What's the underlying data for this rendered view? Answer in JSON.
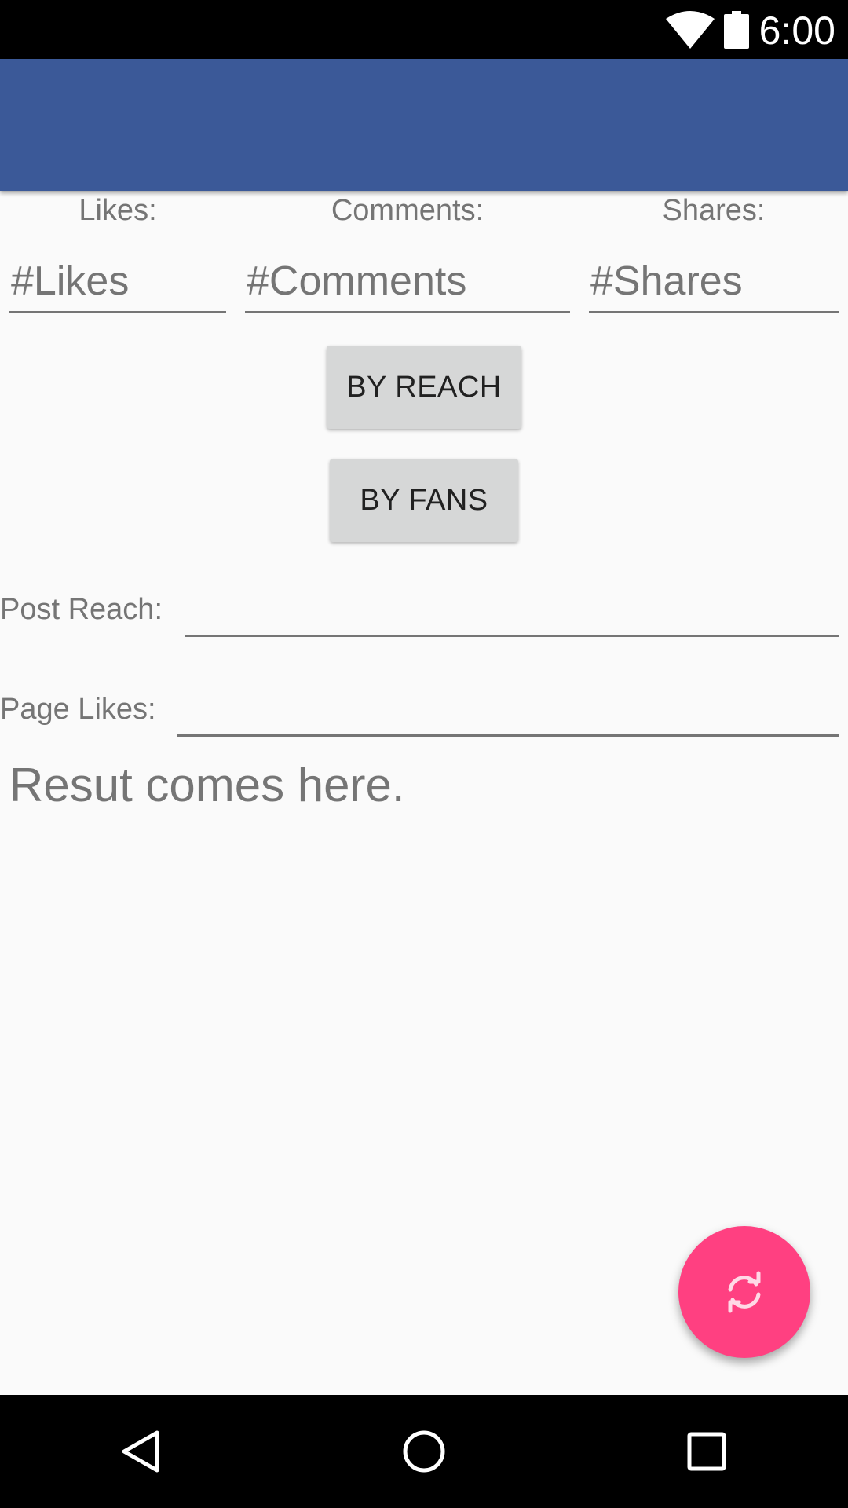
{
  "status_bar": {
    "time": "6:00",
    "wifi_icon": "wifi-icon",
    "battery_icon": "battery-icon"
  },
  "app_bar": {
    "color": "#3b5998"
  },
  "columns": [
    {
      "label": "Likes:",
      "placeholder": "#Likes"
    },
    {
      "label": "Comments:",
      "placeholder": "#Comments"
    },
    {
      "label": "Shares:",
      "placeholder": "#Shares"
    }
  ],
  "buttons": {
    "by_reach": "BY REACH",
    "by_fans": "BY FANS"
  },
  "rows": {
    "post_reach_label": "Post Reach:",
    "page_likes_label": "Page Likes:"
  },
  "result_text": "Resut comes here.",
  "fab": {
    "icon": "refresh-icon",
    "color": "#ff4081"
  },
  "nav_bar": {
    "back_icon": "back-icon",
    "home_icon": "home-icon",
    "recents_icon": "recents-icon"
  }
}
